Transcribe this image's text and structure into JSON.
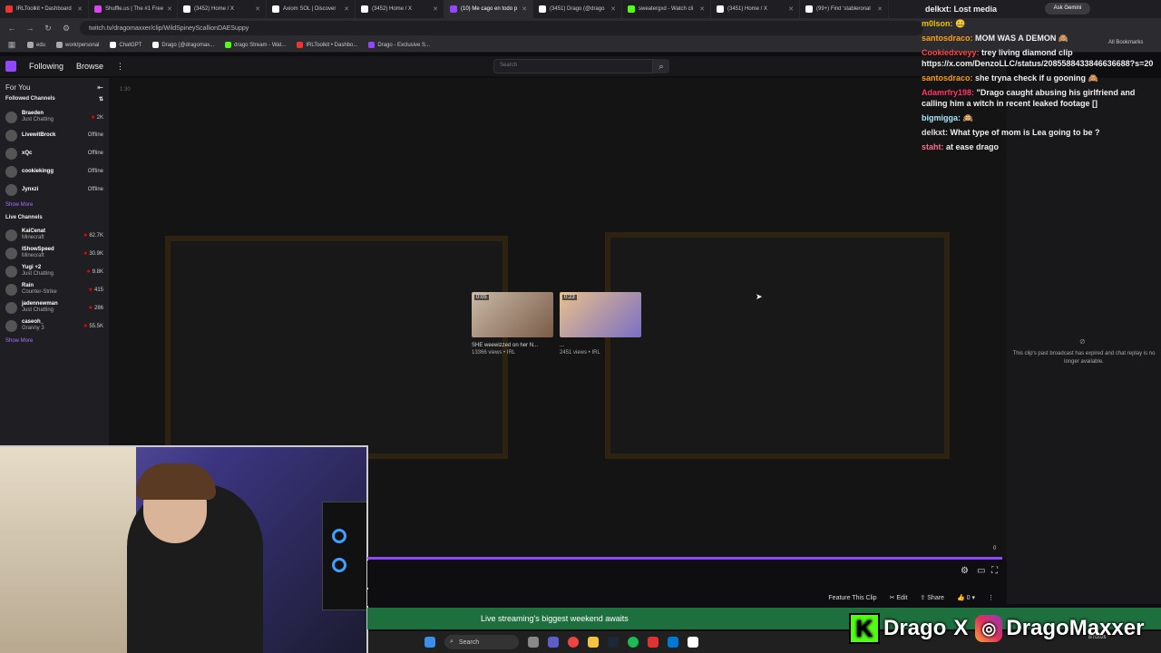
{
  "browser": {
    "tabs": [
      {
        "label": "IRLToolkit • Dashboard",
        "color": "#e33"
      },
      {
        "label": "Shuffle.us | The #1 Free",
        "color": "#d946ef"
      },
      {
        "label": "(3452) Home / X",
        "color": "#fff"
      },
      {
        "label": "Axiom SOL | Discover",
        "color": "#fff"
      },
      {
        "label": "(3452) Home / X",
        "color": "#fff"
      },
      {
        "label": "(10) Me cago en todo p",
        "color": "#9147ff"
      },
      {
        "label": "(3451) Drago (@drago",
        "color": "#fff"
      },
      {
        "label": "sweatergxd - Watch cli",
        "color": "#53fc18"
      },
      {
        "label": "(3451) Home / X",
        "color": "#fff"
      },
      {
        "label": "(99+) Find 'stableronal",
        "color": "#fff"
      }
    ],
    "url": "twitch.tv/dragomaxxer/clip/WildSpineyScallionDAESuppy",
    "ask_gemini": "Ask Gemini",
    "all_bookmarks": "All Bookmarks",
    "bookmarks": [
      {
        "label": "edu",
        "color": "#aaa"
      },
      {
        "label": "work/personal",
        "color": "#aaa"
      },
      {
        "label": "ChatGPT",
        "color": "#fff"
      },
      {
        "label": "Drago (@dragomax...",
        "color": "#fff"
      },
      {
        "label": "drago Stream - Wat...",
        "color": "#53fc18"
      },
      {
        "label": "IRLToolkit • Dashbo...",
        "color": "#e33"
      },
      {
        "label": "Drago - Exclusive S...",
        "color": "#9147ff"
      }
    ]
  },
  "twitch": {
    "nav": {
      "following": "Following",
      "browse": "Browse",
      "search_placeholder": "Search"
    },
    "sidebar": {
      "for_you": "For You",
      "followed_title": "Followed Channels",
      "followed": [
        {
          "name": "Braeden",
          "sub": "Just Chatting",
          "viewers": "2K",
          "live": true
        },
        {
          "name": "LivewitBrock",
          "sub": "",
          "viewers": "Offline",
          "live": false
        },
        {
          "name": "xQc",
          "sub": "",
          "viewers": "Offline",
          "live": false
        },
        {
          "name": "cookiekingg",
          "sub": "",
          "viewers": "Offline",
          "live": false
        },
        {
          "name": "Jynxzi",
          "sub": "",
          "viewers": "Offline",
          "live": false
        }
      ],
      "show_more": "Show More",
      "live_title": "Live Channels",
      "live": [
        {
          "name": "KaiCenat",
          "sub": "Minecraft",
          "viewers": "82.7K"
        },
        {
          "name": "IShowSpeed",
          "sub": "Minecraft",
          "viewers": "30.9K"
        },
        {
          "name": "Yugi +2",
          "sub": "Just Chatting",
          "viewers": "9.8K"
        },
        {
          "name": "Rain",
          "sub": "Counter-Strike",
          "viewers": "415"
        },
        {
          "name": "jadennewman",
          "sub": "Just Chatting",
          "viewers": "286"
        },
        {
          "name": "caseoh_",
          "sub": "Granny 3",
          "viewers": "55.5K"
        }
      ],
      "show_more_2": "Show More"
    },
    "player": {
      "timestamp": "1:30",
      "clips": [
        {
          "duration": "0:05",
          "title": "SHE weewizzed on her N...",
          "meta": "13366 views • IRL"
        },
        {
          "duration": "0:23",
          "title": "...",
          "meta": "2451 views • IRL"
        }
      ],
      "progress_end": "0"
    },
    "actions": {
      "feature": "Feature This Clip",
      "edit": "Edit",
      "share": "Share",
      "likes": "0"
    },
    "banner": "Live streaming's biggest weekend awaits",
    "chat_expired": "This clip's past broadcast has expired and chat replay is no longer available."
  },
  "chat": {
    "header": "delkxt: Lost media",
    "messages": [
      {
        "user": "m0lson:",
        "text": "🤐",
        "color": "#f0c000"
      },
      {
        "user": "santosdraco:",
        "text": "MOM WAS A DEMON 🙈",
        "color": "#ff9f1a"
      },
      {
        "user": "Cookiedxveyy:",
        "text": "trey living diamond clip https://x.com/DenzoLLC/status/2085588433846636688?s=20",
        "color": "#ff4444"
      },
      {
        "user": "santosdraco:",
        "text": "she tryna check if u gooning 🙈",
        "color": "#ff9f1a"
      },
      {
        "user": "Adamrfry198:",
        "text": "\"Drago caught abusing his girlfriend and calling him a witch in recent leaked footage []",
        "color": "#ff3366"
      },
      {
        "user": "bigmigga:",
        "text": "🙉",
        "color": "#a8e6ff"
      },
      {
        "user": "delkxt:",
        "text": "What type of mom is Lea going to be ?",
        "color": "#dddddd"
      },
      {
        "user": "staht:",
        "text": "at ease drago",
        "color": "#ff6b8b"
      }
    ]
  },
  "overlay": {
    "kick_letter": "K",
    "kick_name": "Drago",
    "x": "X",
    "ig_name": "DragoMaxxer"
  },
  "taskbar": {
    "search": "Search",
    "date": "8/7/2026"
  }
}
